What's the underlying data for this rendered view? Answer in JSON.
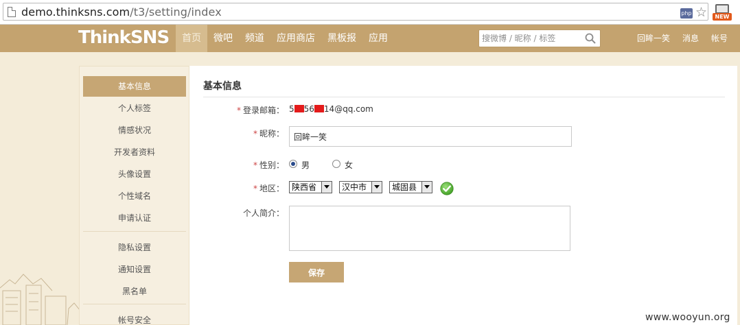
{
  "browser": {
    "url_host": "demo.thinksns.com",
    "url_path": "/t3/setting/index",
    "php_badge": "php",
    "new_badge": "NEW"
  },
  "header": {
    "logo": "ThinkSNS",
    "nav": [
      "首页",
      "微吧",
      "频道",
      "应用商店",
      "黑板报",
      "应用"
    ],
    "search_placeholder": "搜微博 / 昵称 / 标签",
    "user_links": [
      "回眸一笑",
      "消息",
      "帐号"
    ]
  },
  "sidebar": {
    "items": [
      "基本信息",
      "个人标签",
      "情感状况",
      "开发者资料",
      "头像设置",
      "个性域名",
      "申请认证",
      "隐私设置",
      "通知设置",
      "黑名单",
      "帐号安全"
    ],
    "active_index": 0
  },
  "form": {
    "title": "基本信息",
    "required_mark": "*",
    "email_label": "登录邮箱：",
    "email_parts": [
      "5",
      "56",
      "14@qq.com"
    ],
    "nickname_label": "昵称：",
    "nickname_value": "回眸一笑",
    "gender_label": "性别：",
    "gender_options": [
      "男",
      "女"
    ],
    "gender_selected": "男",
    "region_label": "地区：",
    "province": "陕西省",
    "city": "汉中市",
    "county": "城固县",
    "intro_label": "个人简介：",
    "intro_value": "",
    "save_label": "保存"
  },
  "watermark": "www.wooyun.org",
  "colors": {
    "header_bg": "#c4a36f",
    "accent": "#c6a674",
    "page_bg": "#f4ecd9",
    "redaction": "#e31b1b",
    "ok_green": "#4fb62e"
  }
}
